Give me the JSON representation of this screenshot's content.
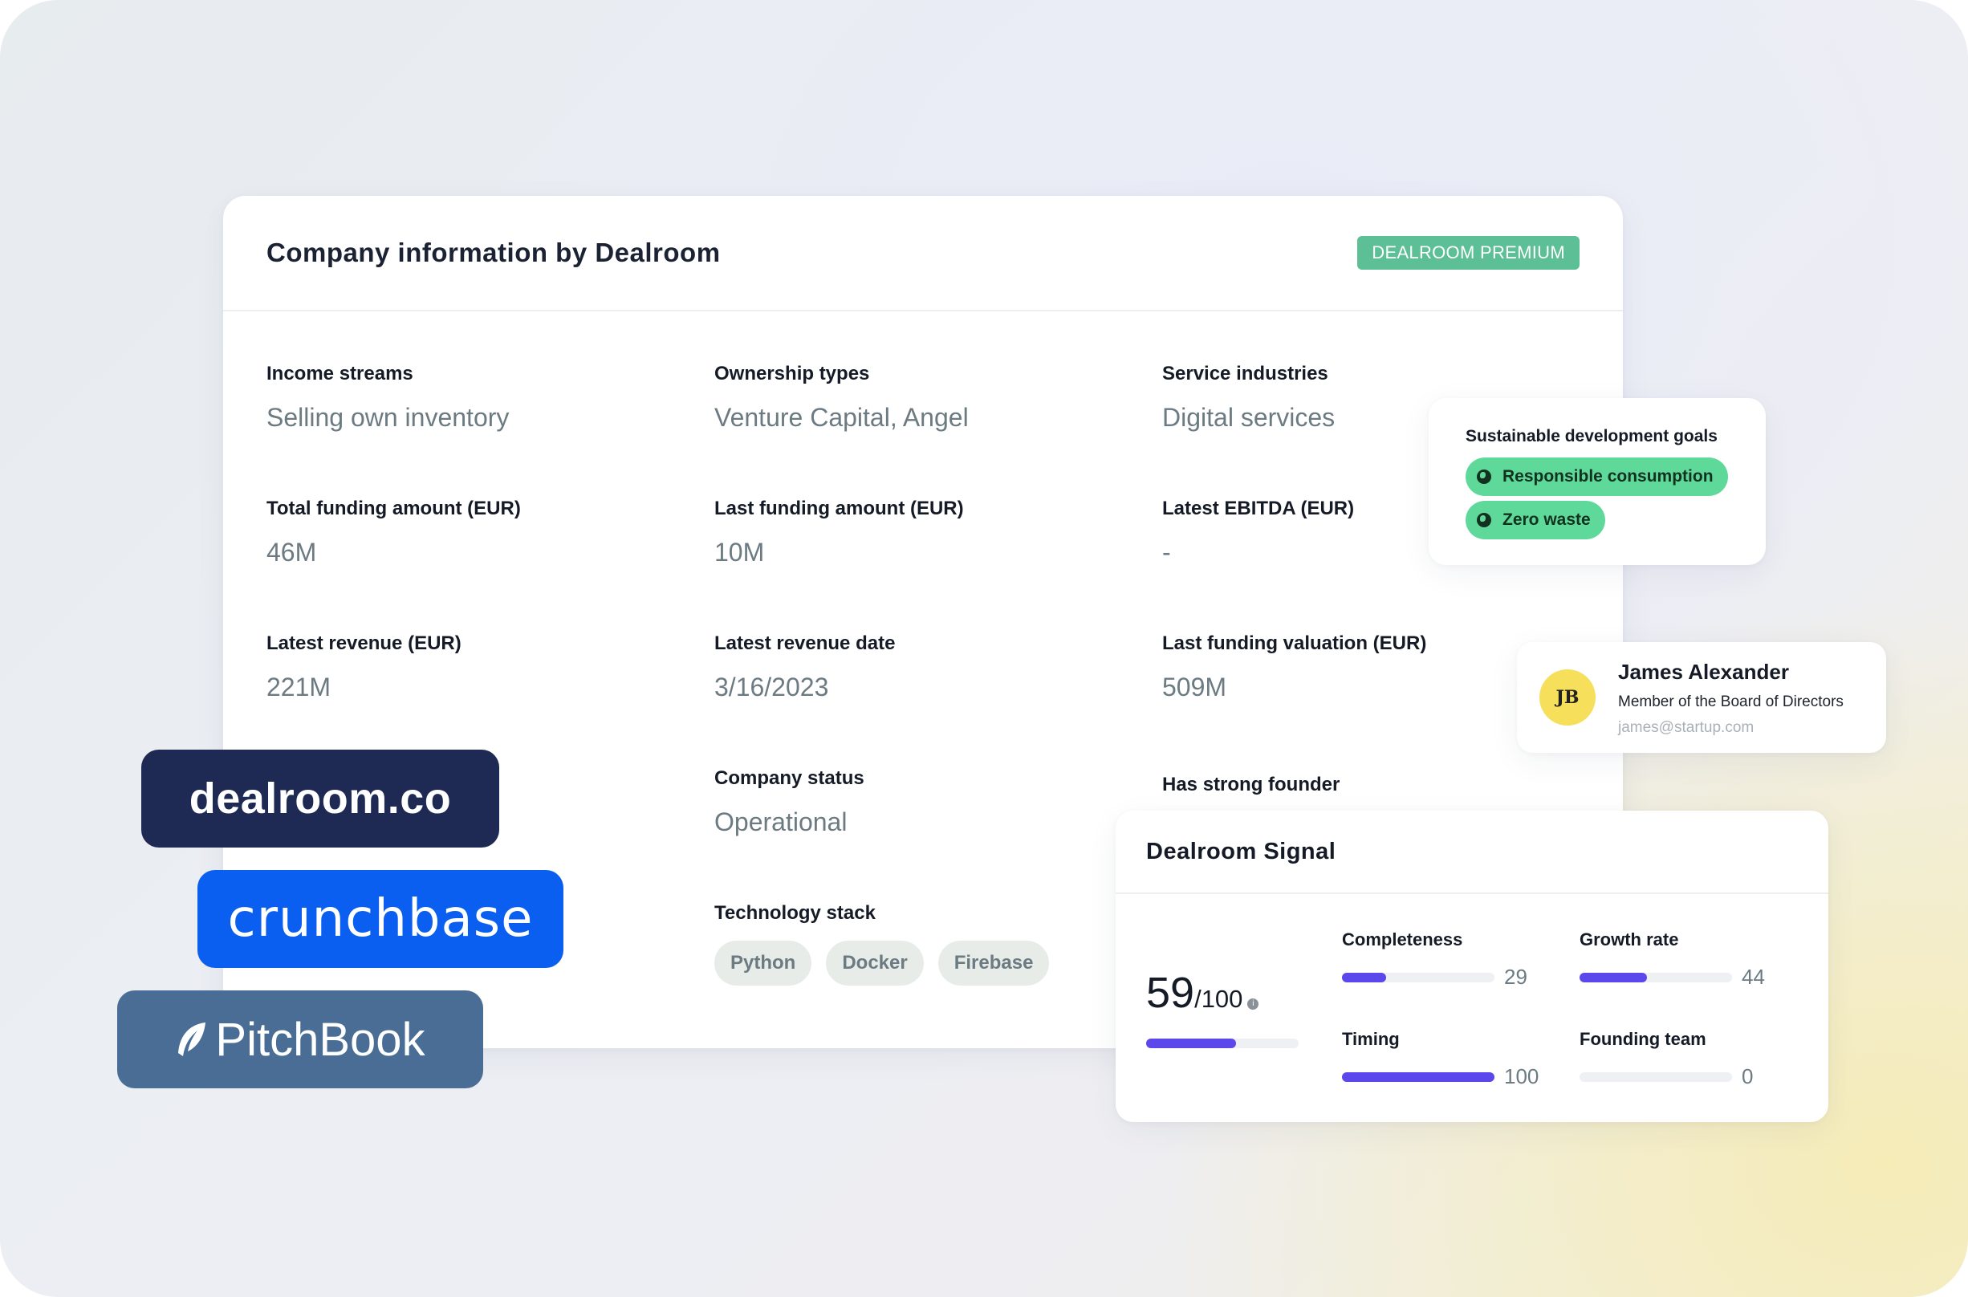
{
  "main_card": {
    "title": "Company information by Dealroom",
    "badge": "DEALROOM PREMIUM",
    "fields": [
      {
        "label": "Income streams",
        "value": "Selling own inventory"
      },
      {
        "label": "Ownership types",
        "value": "Venture Capital, Angel"
      },
      {
        "label": "Service industries",
        "value": "Digital services"
      },
      {
        "label": "Total funding amount (EUR)",
        "value": "46M"
      },
      {
        "label": "Last funding amount (EUR)",
        "value": "10M"
      },
      {
        "label": "Latest EBITDA (EUR)",
        "value": "-"
      },
      {
        "label": "Latest revenue (EUR)",
        "value": "221M"
      },
      {
        "label": "Latest revenue date",
        "value": "3/16/2023"
      },
      {
        "label": "Last funding valuation (EUR)",
        "value": "509M"
      },
      {
        "label": "Company status",
        "value": "Operational"
      },
      {
        "label": "Has strong founder",
        "value": ""
      }
    ],
    "tech_stack": {
      "label": "Technology stack",
      "items": [
        "Python",
        "Docker",
        "Firebase"
      ]
    }
  },
  "sdg": {
    "title": "Sustainable development goals",
    "goals": [
      "Responsible consumption",
      "Zero waste"
    ],
    "pill_color": "#5fd99a",
    "icon": "globe-icon"
  },
  "person": {
    "initials": "JB",
    "name": "James Alexander",
    "role": "Member of the Board of Directors",
    "email": "james@startup.com",
    "avatar_color": "#f6df5a"
  },
  "signal": {
    "title": "Dealroom Signal",
    "score": "59",
    "score_total": "/100",
    "score_fraction": 0.59,
    "bar_color": "#5b47eb",
    "metrics": [
      {
        "label": "Completeness",
        "value": "29",
        "fraction": 0.29
      },
      {
        "label": "Growth rate",
        "value": "44",
        "fraction": 0.44
      },
      {
        "label": "Timing",
        "value": "100",
        "fraction": 1.0
      },
      {
        "label": "Founding team",
        "value": "0",
        "fraction": 0.0
      }
    ]
  },
  "logos": {
    "dealroom": "dealroom.co",
    "crunchbase": "crunchbase",
    "pitchbook": "PitchBook"
  },
  "colors": {
    "premium_badge": "#5cbf95",
    "dealroom_logo": "#1e2a53",
    "crunchbase_logo": "#0a5ef0",
    "pitchbook_logo": "#4a6d96"
  }
}
